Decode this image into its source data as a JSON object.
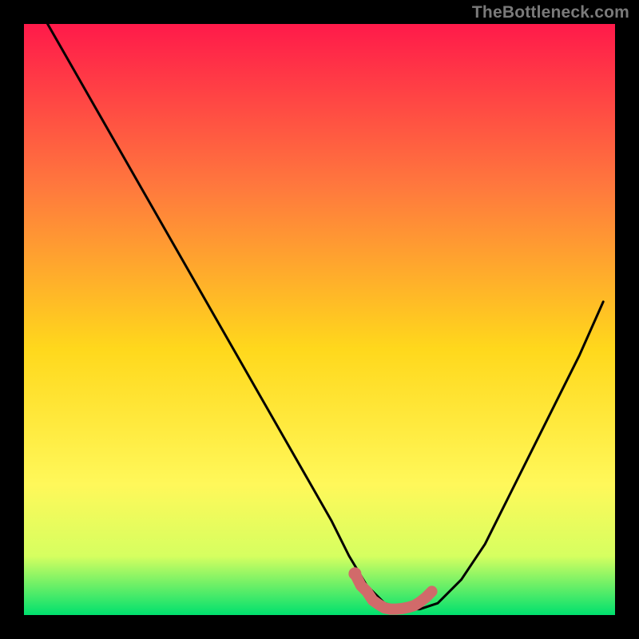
{
  "watermark": "TheBottleneck.com",
  "colors": {
    "gradient_top": "#ff1a4a",
    "gradient_mid1": "#ff7a3d",
    "gradient_mid2": "#ffd81c",
    "gradient_mid3": "#fff85a",
    "gradient_mid4": "#d6ff60",
    "gradient_bottom": "#00e06e",
    "curve": "#000000",
    "highlight": "#d16a6a",
    "frame": "#000000"
  },
  "chart_data": {
    "type": "line",
    "title": "",
    "xlabel": "",
    "ylabel": "",
    "xlim": [
      0,
      100
    ],
    "ylim": [
      0,
      100
    ],
    "grid": false,
    "legend": false,
    "series": [
      {
        "name": "bottleneck-curve",
        "x": [
          4,
          8,
          12,
          16,
          20,
          24,
          28,
          32,
          36,
          40,
          44,
          48,
          52,
          55,
          58,
          61,
          64,
          67,
          70,
          74,
          78,
          82,
          86,
          90,
          94,
          98
        ],
        "y": [
          100,
          93,
          86,
          79,
          72,
          65,
          58,
          51,
          44,
          37,
          30,
          23,
          16,
          10,
          5,
          2,
          1,
          1,
          2,
          6,
          12,
          20,
          28,
          36,
          44,
          53
        ]
      }
    ],
    "highlight_segment": {
      "name": "optimal-range",
      "x": [
        56,
        57,
        58,
        59,
        60,
        61,
        62,
        63,
        64,
        65,
        66,
        67,
        68,
        69
      ],
      "y": [
        7,
        5,
        4,
        2.5,
        1.8,
        1.2,
        1,
        1,
        1.1,
        1.3,
        1.6,
        2.2,
        3,
        4
      ]
    }
  }
}
